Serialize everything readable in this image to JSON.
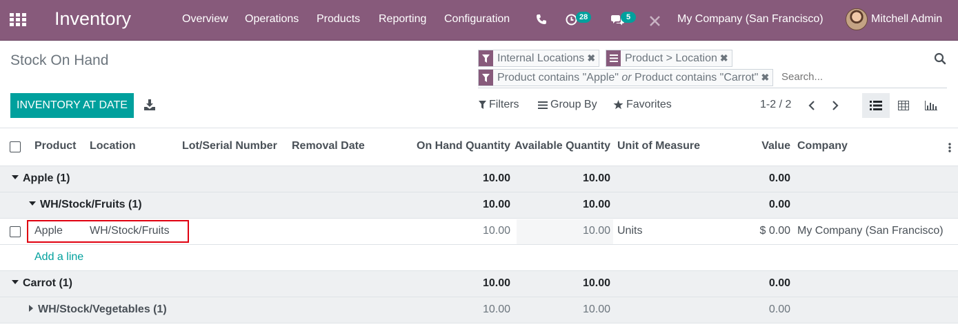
{
  "navbar": {
    "brand": "Inventory",
    "menu": [
      "Overview",
      "Operations",
      "Products",
      "Reporting",
      "Configuration"
    ],
    "activity_count": "28",
    "message_count": "5",
    "company": "My Company (San Francisco)",
    "user": "Mitchell Admin",
    "accent_color": "#875a7b"
  },
  "control_panel": {
    "title": "Stock On Hand",
    "primary_button": "INVENTORY AT DATE",
    "facets": {
      "f1": "Internal Locations",
      "f2": "Product > Location",
      "f3_part1": "Product contains \"Apple\"",
      "f3_or": "or",
      "f3_part2": "Product contains \"Carrot\""
    },
    "search_placeholder": "Search...",
    "filters_label": "Filters",
    "groupby_label": "Group By",
    "favorites_label": "Favorites",
    "pager": "1-2 / 2"
  },
  "table": {
    "columns": {
      "product": "Product",
      "location": "Location",
      "lot": "Lot/Serial Number",
      "removal": "Removal Date",
      "onhand": "On Hand Quantity",
      "available": "Available Quantity",
      "uom": "Unit of Measure",
      "value": "Value",
      "company": "Company"
    },
    "rows": [
      {
        "label": "Apple (1)",
        "onhand": "10.00",
        "available": "10.00",
        "value": "0.00"
      },
      {
        "label": "WH/Stock/Fruits (1)",
        "onhand": "10.00",
        "available": "10.00",
        "value": "0.00"
      },
      {
        "product": "Apple",
        "location": "WH/Stock/Fruits",
        "onhand": "10.00",
        "available": "10.00",
        "uom": "Units",
        "value": "$ 0.00",
        "company": "My Company (San Francisco)"
      },
      {
        "add_line": "Add a line"
      },
      {
        "label": "Carrot (1)",
        "onhand": "10.00",
        "available": "10.00",
        "value": "0.00"
      },
      {
        "label": "WH/Stock/Vegetables (1)",
        "onhand": "10.00",
        "available": "10.00",
        "value": "0.00"
      }
    ]
  }
}
